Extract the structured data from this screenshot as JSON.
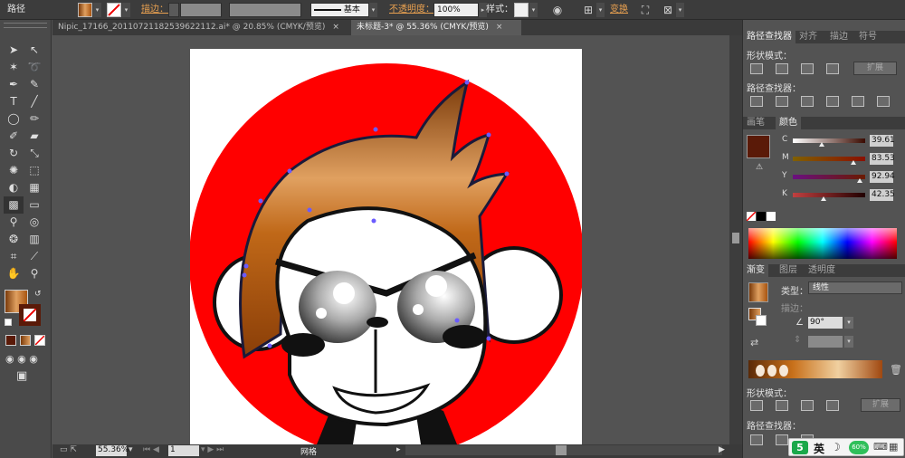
{
  "control_bar": {
    "title": "路径",
    "stroke_label": "描边：",
    "stroke_style": "基本",
    "opacity_label": "不透明度：",
    "opacity_value": "100%",
    "style_label": "样式：",
    "transform_label": "变换",
    "fill_color": "#b85a10",
    "accent": "#e8a050"
  },
  "document_tabs": [
    {
      "label": "Nipic_17166_20110721182539622112.ai* @ 20.85% (CMYK/预览)",
      "close": "×"
    },
    {
      "label": "未标题-3* @ 55.36% (CMYK/预览)",
      "close": "×"
    }
  ],
  "status_bar": {
    "zoom": "55.36%",
    "page": "1",
    "tool_name": "网格"
  },
  "pathfinder_panel": {
    "tabs": [
      "路径查找器",
      "对齐",
      "描边",
      "符号"
    ],
    "shape_modes_label": "形状模式：",
    "expand_label": "扩展",
    "pathfinders_label": "路径查找器："
  },
  "color_panel": {
    "tabs": [
      "画笔",
      "颜色"
    ],
    "channels": [
      {
        "name": "C",
        "value": "39.61",
        "pos": 0.4,
        "grad": [
          "#ffffff",
          "#3a0a00"
        ]
      },
      {
        "name": "M",
        "value": "83.53",
        "pos": 0.84,
        "grad": [
          "#806000",
          "#8a1000"
        ]
      },
      {
        "name": "Y",
        "value": "92.94",
        "pos": 0.93,
        "grad": [
          "#6a1080",
          "#6a1a00"
        ]
      },
      {
        "name": "K",
        "value": "42.35",
        "pos": 0.42,
        "grad": [
          "#c04040",
          "#200000"
        ]
      }
    ],
    "current_color": "#5a1a08"
  },
  "gradient_panel": {
    "tabs": [
      "渐变",
      "图层",
      "透明度"
    ],
    "type_label": "类型：",
    "type_value": "线性",
    "stroke_label": "描边：",
    "angle_value": "90°",
    "shape_modes_label": "形状模式：",
    "expand_label": "扩展",
    "pathfinders_label": "路径查找器：",
    "stops": [
      "#5a2a08",
      "#c8701a",
      "#f0d0a0",
      "#a04810"
    ]
  },
  "ime": {
    "badge": "5",
    "lang": "英",
    "percent": "60%"
  },
  "artwork": {
    "bg_circle": "#ff0000",
    "hair_gradient": [
      "#7a3a0a",
      "#e0a060",
      "#a85410"
    ]
  }
}
